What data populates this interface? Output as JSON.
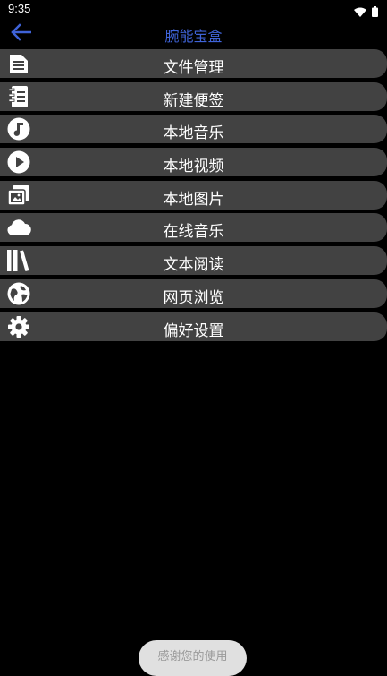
{
  "status_bar": {
    "time": "9:35"
  },
  "app_bar": {
    "title": "腕能宝盒"
  },
  "menu": {
    "items": [
      {
        "label": "文件管理",
        "icon": "file-icon"
      },
      {
        "label": "新建便签",
        "icon": "notebook-icon"
      },
      {
        "label": "本地音乐",
        "icon": "music-note-icon"
      },
      {
        "label": "本地视频",
        "icon": "play-icon"
      },
      {
        "label": "本地图片",
        "icon": "image-icon"
      },
      {
        "label": "在线音乐",
        "icon": "cloud-icon"
      },
      {
        "label": "文本阅读",
        "icon": "library-books-icon"
      },
      {
        "label": "网页浏览",
        "icon": "globe-icon"
      },
      {
        "label": "偏好设置",
        "icon": "gear-icon"
      }
    ]
  },
  "toast": {
    "text": "感谢您的使用"
  },
  "colors": {
    "accent": "#3f63d8",
    "item_bg": "#424242",
    "background": "#000000"
  }
}
